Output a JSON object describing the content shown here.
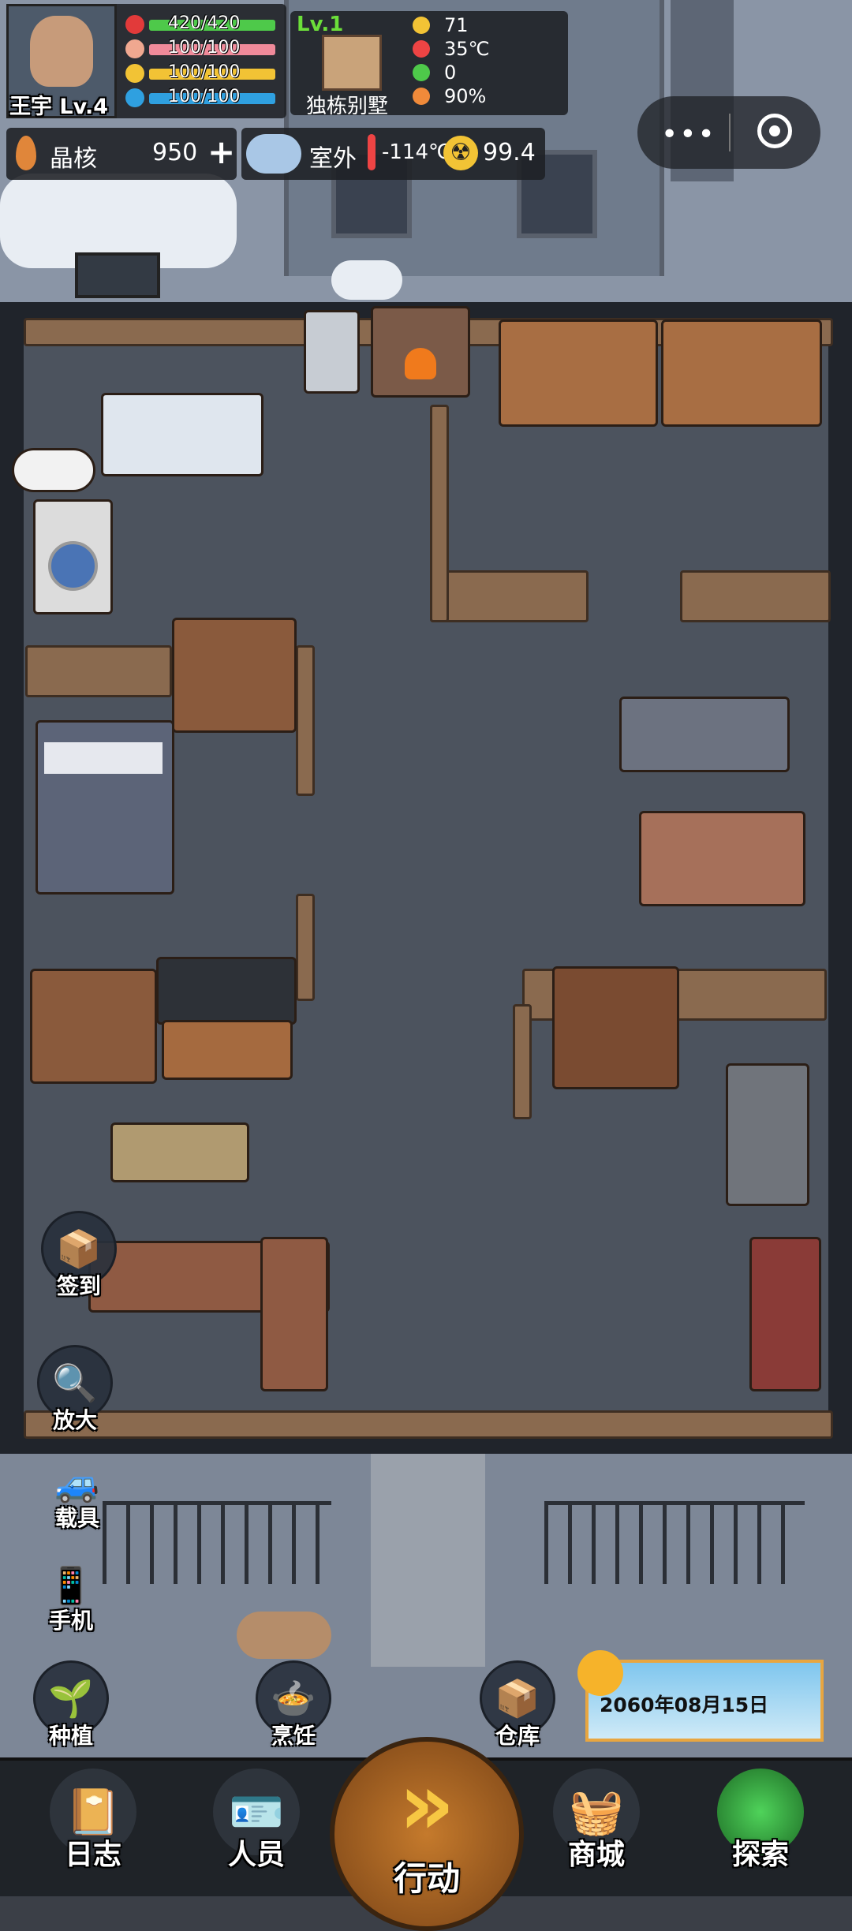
{
  "player": {
    "name_level": "王宇 Lv.4",
    "stats": [
      {
        "icon": "heart-icon",
        "value": "420/420",
        "color": "#e23a3a",
        "bar": "#4ec94a",
        "fill": 1.0
      },
      {
        "icon": "stomach-icon",
        "value": "100/100",
        "color": "#f0a890",
        "bar": "#f08a9a",
        "fill": 1.0
      },
      {
        "icon": "energy-icon",
        "value": "100/100",
        "color": "#f2c335",
        "bar": "#f2c335",
        "fill": 1.0
      },
      {
        "icon": "water-icon",
        "value": "100/100",
        "color": "#2fa0e0",
        "bar": "#2fa0e0",
        "fill": 1.0
      }
    ]
  },
  "house": {
    "level": "Lv.1",
    "name": "独栋别墅",
    "stats": [
      {
        "icon": "radiation-icon",
        "value": "71"
      },
      {
        "icon": "thermometer-icon",
        "value": "35℃"
      },
      {
        "icon": "battery-icon",
        "value": "0"
      },
      {
        "icon": "pie-icon",
        "value": "90%"
      }
    ]
  },
  "crystal": {
    "label": "晶核",
    "value": "950",
    "plus": "+"
  },
  "outdoor": {
    "label": "室外",
    "temp": "-114℃",
    "radiation": "99.4"
  },
  "side_buttons": {
    "checkin": "签到",
    "zoom": "放大",
    "vehicle": "载具",
    "phone": "手机"
  },
  "action_buttons": {
    "plant": "种植",
    "cook": "烹饪",
    "storage": "仓库"
  },
  "date": "2060年08月15日",
  "nav": {
    "log": "日志",
    "people": "人员",
    "action": "行动",
    "shop": "商城",
    "explore": "探索"
  },
  "colors": {
    "level_green": "#6cdf3a",
    "accent_gold": "#e8a640"
  }
}
